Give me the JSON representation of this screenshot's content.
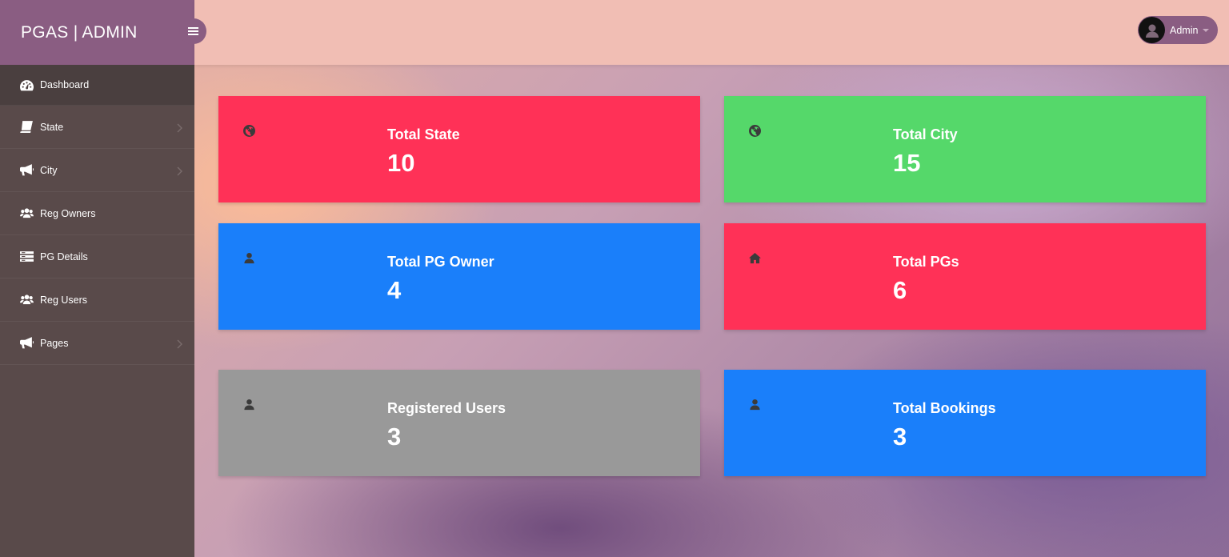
{
  "brand": {
    "title": "PGAS | ADMIN"
  },
  "header": {
    "user_name": "Admin"
  },
  "sidebar": {
    "items": [
      {
        "label": "Dashboard",
        "icon": "dashboard-icon",
        "has_submenu": false,
        "active": true
      },
      {
        "label": "State",
        "icon": "book-icon",
        "has_submenu": true
      },
      {
        "label": "City",
        "icon": "bullhorn-icon",
        "has_submenu": true
      },
      {
        "label": "Reg Owners",
        "icon": "users-icon",
        "has_submenu": false
      },
      {
        "label": "PG Details",
        "icon": "list-icon",
        "has_submenu": false
      },
      {
        "label": "Reg Users",
        "icon": "users-icon",
        "has_submenu": false
      },
      {
        "label": "Pages",
        "icon": "bullhorn-icon",
        "has_submenu": true
      }
    ]
  },
  "cards": [
    {
      "title": "Total State",
      "value": "10",
      "icon": "globe-icon",
      "color": "#ff3157"
    },
    {
      "title": "Total City",
      "value": "15",
      "icon": "globe-icon",
      "color": "#55d86a"
    },
    {
      "title": "Total PG Owner",
      "value": "4",
      "icon": "user-icon",
      "color": "#1a7ffa"
    },
    {
      "title": "Total PGs",
      "value": "6",
      "icon": "home-icon",
      "color": "#ff3157"
    },
    {
      "title": "Registered Users",
      "value": "3",
      "icon": "user-icon",
      "color": "#999999"
    },
    {
      "title": "Total Bookings",
      "value": "3",
      "icon": "user-icon",
      "color": "#1a7ffa"
    }
  ],
  "colors": {
    "sidebar": "#594a4a",
    "brand": "#8a5d82",
    "header": "#f1beb4"
  }
}
